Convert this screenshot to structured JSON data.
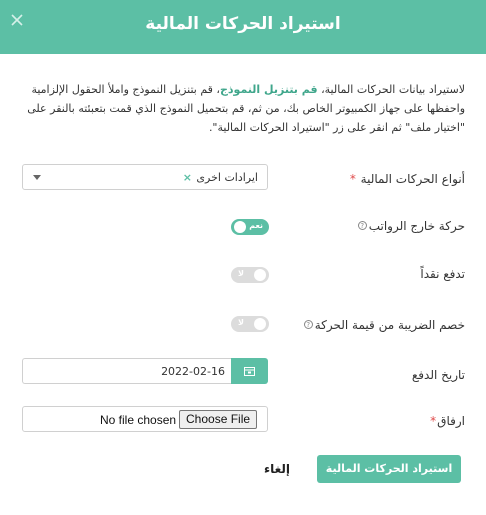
{
  "dialog": {
    "title": "استيراد الحركات المالية",
    "close_icon": "close-icon"
  },
  "intro": {
    "part1": "لاستيراد بيانات الحركات المالية، ",
    "link": "قم بتنزيل النموذج",
    "part2": "، قم بتنزيل النموذج واملأ الحقول الإلزامية واحفظها على جهاز الكمبيوتر الخاص بك، من ثم، قم بتحميل النموذج الذي قمت بتعبئته بالنقر على \"اختيار ملف\" ثم انقر على زر \"استيراد الحركات المالية\"."
  },
  "fields": {
    "types": {
      "label": "أنواع الحركات المالية",
      "required_mark": "*",
      "selected": "ايرادات اخرى",
      "clear": "×"
    },
    "outside_salaries": {
      "label": "حركة خارج الرواتب",
      "help": "?",
      "state": "on",
      "toggle_text": "نعم"
    },
    "cash_paid": {
      "label": "تدفع نقداً",
      "state": "off",
      "toggle_text": "لا"
    },
    "tax_deduct": {
      "label": "خصم الضريبة من قيمة الحركة",
      "help": "?",
      "state": "off",
      "toggle_text": "لا"
    },
    "pay_date": {
      "label": "تاريخ الدفع",
      "value": "2022-02-16",
      "icon": "calendar-icon"
    },
    "attachment": {
      "label": "ارفاق",
      "required_mark": "*",
      "button": "Choose File",
      "status": "No file chosen"
    }
  },
  "actions": {
    "submit": "استيراد الحركات المالية",
    "cancel": "إلغاء"
  },
  "colors": {
    "accent": "#5cbfa5",
    "link": "#3fa68b",
    "required": "#e04b4b",
    "toggle_off": "#dcdcdc"
  }
}
